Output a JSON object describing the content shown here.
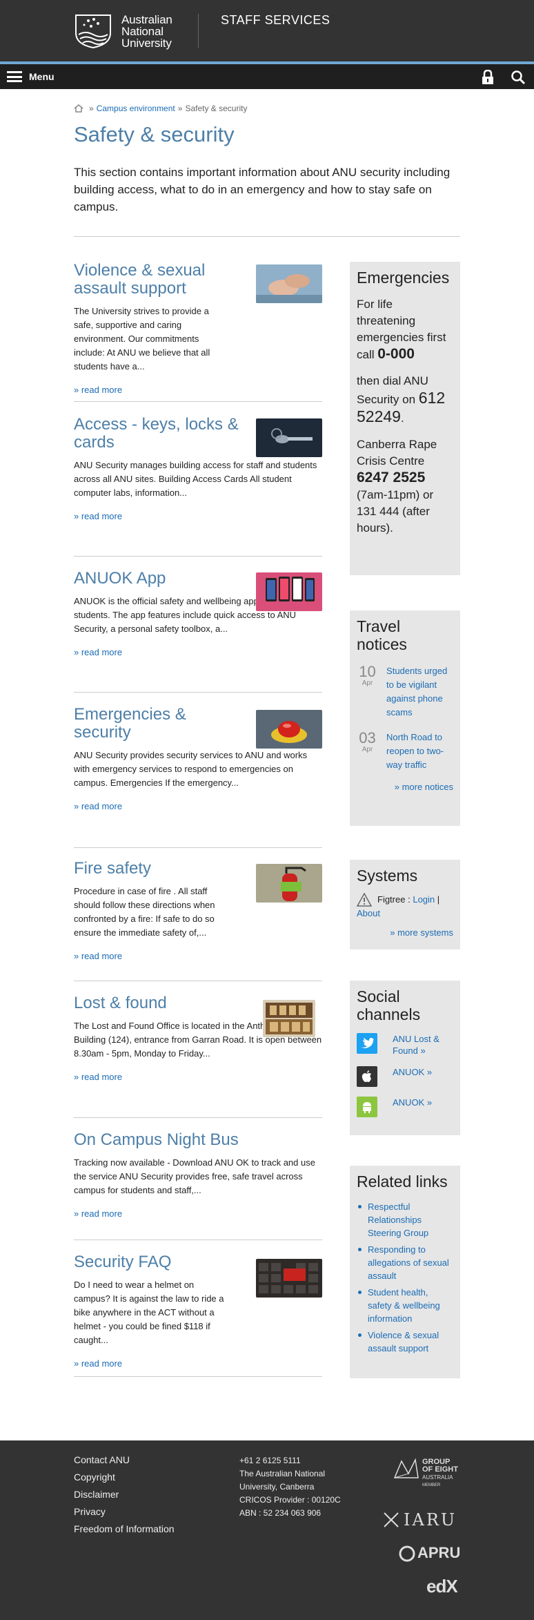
{
  "header": {
    "logo_lines": [
      "Australian",
      "National",
      "University"
    ],
    "site_name": "STAFF SERVICES",
    "menu_label": "Menu"
  },
  "breadcrumb": {
    "sep1": "»",
    "link": "Campus environment",
    "sep2": "»",
    "current": "Safety & security"
  },
  "page": {
    "title": "Safety & security",
    "intro": "This section contains important information about ANU security including building access, what to do in an emergency and how to stay safe on campus."
  },
  "articles": [
    {
      "title": "Violence & sexual assault support",
      "summary": "The University strives to provide a safe, supportive and caring environment. Our commitments include: At ANU we believe that all students have a...",
      "more": "» read more",
      "image": "hands-photo"
    },
    {
      "title": "Access - keys, locks & cards",
      "summary": "ANU Security manages building access for staff and students across all ANU sites. Building Access Cards All student computer labs, information...",
      "more": "» read more",
      "image": "keys-photo"
    },
    {
      "title": "ANUOK App",
      "summary": "ANUOK is the official safety and wellbeing app for ANU students. The app features include quick access to ANU Security, a personal safety toolbox, a...",
      "more": "» read more",
      "image": "phones-photo"
    },
    {
      "title": "Emergencies & security",
      "summary": "ANU Security provides security services to ANU and works with emergency services to respond to emergencies on campus. Emergencies If the emergency...",
      "more": "» read more",
      "image": "alarm-button-photo"
    },
    {
      "title": "Fire safety",
      "summary": "Procedure in case of fire . All staff should follow these directions when confronted by a fire: If safe to do so ensure the immediate safety of,...",
      "more": "» read more",
      "image": "fire-extinguisher-photo"
    },
    {
      "title": "Lost & found",
      "summary": "The Lost and Found Office is located in the Anthony Low Building (124), entrance from Garran Road. It is open between 8.30am - 5pm, Monday to Friday...",
      "more": "» read more",
      "image": "lost-found-sign"
    },
    {
      "title": "On Campus Night Bus",
      "summary": "Tracking now available - Download ANU OK to track and use the service ANU Security provides free, safe travel across campus for students and staff,...",
      "more": "» read more",
      "image": ""
    },
    {
      "title": "Security FAQ",
      "summary": "Do I need to wear a helmet on campus? It is against the law to ride a bike anywhere in the ACT without a helmet - you could be fined $118 if caught...",
      "more": "» read more",
      "image": "faq-keyboard-photo"
    }
  ],
  "sidebar": {
    "emergencies": {
      "title": "Emergencies",
      "line1": "For life threatening emergencies first call",
      "number1": "0-000",
      "line2": "then dial ANU Security on",
      "number2": "612 52249",
      "line2_end": ".",
      "line3": "Canberra Rape Crisis Centre",
      "number3": "6247 2525",
      "line4": "(7am-11pm) or 131 444 (after hours)."
    },
    "travel": {
      "title": "Travel notices",
      "notices": [
        {
          "day": "10",
          "month": "Apr",
          "text": "Students urged to be vigilant against phone scams"
        },
        {
          "day": "03",
          "month": "Apr",
          "text": "North Road to reopen to two-way traffic"
        }
      ],
      "more": "» more notices"
    },
    "systems": {
      "title": "Systems",
      "name": "Figtree",
      "colon": ":",
      "login": "Login",
      "pipe": "|",
      "about": "About",
      "more": "» more systems"
    },
    "social": {
      "title": "Social channels",
      "items": [
        {
          "label": "ANU Lost & Found »",
          "icon": "twitter-icon",
          "color": "#1da1f2"
        },
        {
          "label": "ANUOK »",
          "icon": "apple-icon",
          "color": "#333333"
        },
        {
          "label": "ANUOK »",
          "icon": "android-icon",
          "color": "#8cc63f"
        }
      ]
    },
    "related": {
      "title": "Related links",
      "links": [
        "Respectful Relationships Steering Group",
        "Responding to allegations of sexual assault",
        "Student health, safety & wellbeing information",
        "Violence & sexual assault support"
      ]
    }
  },
  "footer": {
    "links": [
      "Contact ANU",
      "Copyright",
      "Disclaimer",
      "Privacy",
      "Freedom of Information"
    ],
    "info": [
      "+61 2 6125 5111",
      "The Australian National",
      "University, Canberra",
      "CRICOS Provider : 00120C",
      "ABN : 52 234 063 906"
    ],
    "logos": {
      "go8_line1": "GROUP",
      "go8_line2": "OF EIGHT",
      "go8_line3": "AUSTRALIA",
      "go8_line4": "MEMBER",
      "iaru": "IARU",
      "apru": "APRU",
      "edx": "edX"
    }
  },
  "colors": {
    "title_blue": "#4d7fa8",
    "link_blue": "#1a6cb5",
    "header_bg": "#333333",
    "accent": "#6fa8d6",
    "sidebar_bg": "#e6e6e6"
  }
}
